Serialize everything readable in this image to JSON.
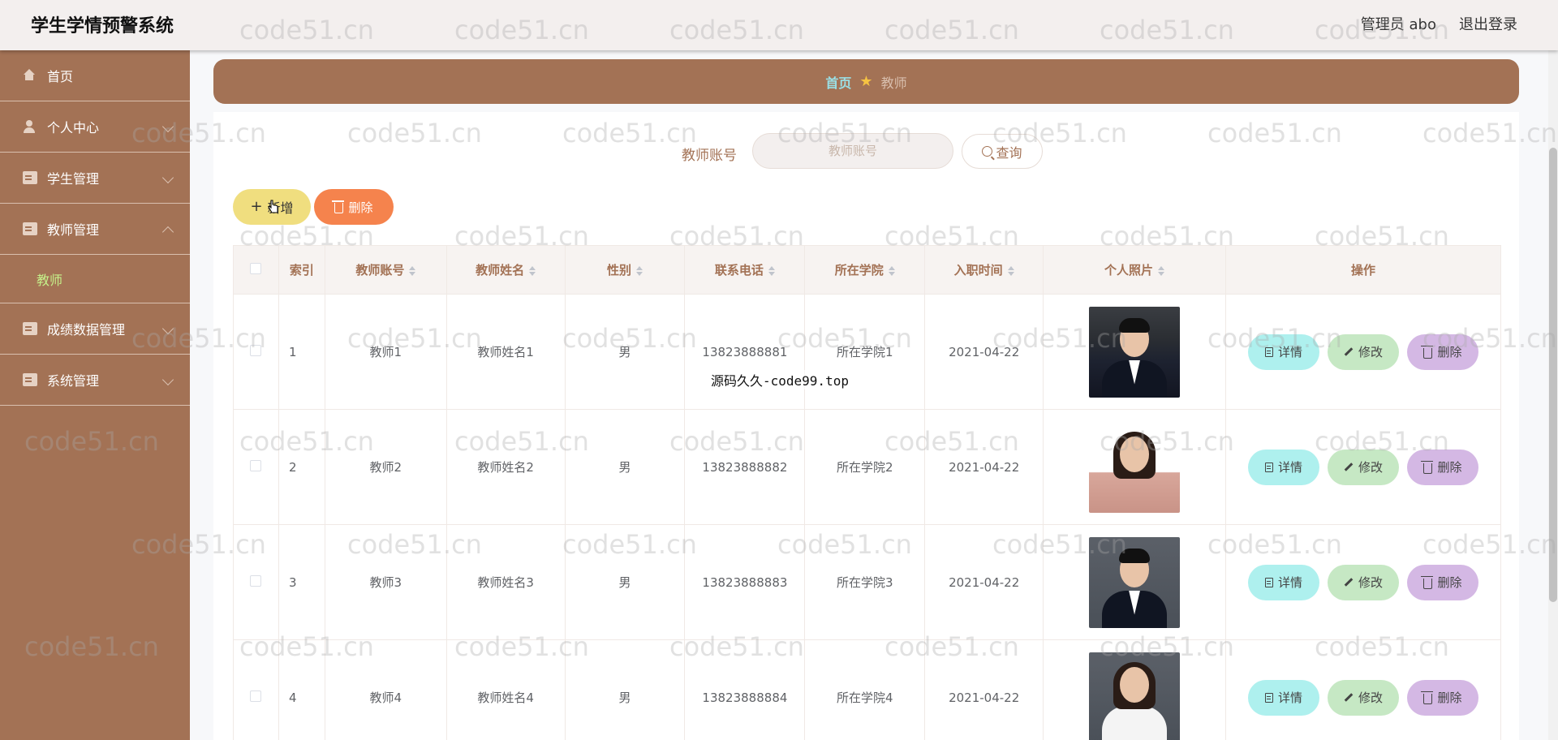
{
  "header": {
    "title": "学生学情预警系统",
    "user_label": "管理员 abo",
    "logout_label": "退出登录"
  },
  "sidebar": {
    "items": [
      {
        "label": "首页",
        "icon": "home-icon"
      },
      {
        "label": "个人中心",
        "icon": "user-icon"
      },
      {
        "label": "学生管理",
        "icon": "doc-icon"
      },
      {
        "label": "教师管理",
        "icon": "doc-icon"
      },
      {
        "label": "成绩数据管理",
        "icon": "doc-icon"
      },
      {
        "label": "系统管理",
        "icon": "doc-icon"
      }
    ],
    "sub_item": "教师"
  },
  "breadcrumb": {
    "home": "首页",
    "current": "教师"
  },
  "search": {
    "label": "教师账号",
    "placeholder": "教师账号",
    "button_label": "查询"
  },
  "toolbar": {
    "add_label": "新增",
    "delete_label": "删除"
  },
  "table": {
    "columns": [
      "索引",
      "教师账号",
      "教师姓名",
      "性别",
      "联系电话",
      "所在学院",
      "入职时间",
      "个人照片",
      "操作"
    ],
    "rows": [
      {
        "index": "1",
        "account": "教师1",
        "name": "教师姓名1",
        "gender": "男",
        "phone": "13823888881",
        "college": "所在学院1",
        "hire_date": "2021-04-22"
      },
      {
        "index": "2",
        "account": "教师2",
        "name": "教师姓名2",
        "gender": "男",
        "phone": "13823888882",
        "college": "所在学院2",
        "hire_date": "2021-04-22"
      },
      {
        "index": "3",
        "account": "教师3",
        "name": "教师姓名3",
        "gender": "男",
        "phone": "13823888883",
        "college": "所在学院3",
        "hire_date": "2021-04-22"
      },
      {
        "index": "4",
        "account": "教师4",
        "name": "教师姓名4",
        "gender": "男",
        "phone": "13823888884",
        "college": "所在学院4",
        "hire_date": "2021-04-22"
      }
    ],
    "actions": {
      "detail": "详情",
      "edit": "修改",
      "delete": "删除"
    }
  },
  "overlay_text": "源码久久-code99.top",
  "watermark": "code51.cn",
  "colors": {
    "sidebar": "#a37255",
    "header": "#f3efee",
    "add_button": "#f0de7f",
    "delete_button": "#f5834d",
    "detail_button": "#aef0ee",
    "edit_button": "#c6e8c4",
    "row_delete_button": "#d4b8e4"
  }
}
